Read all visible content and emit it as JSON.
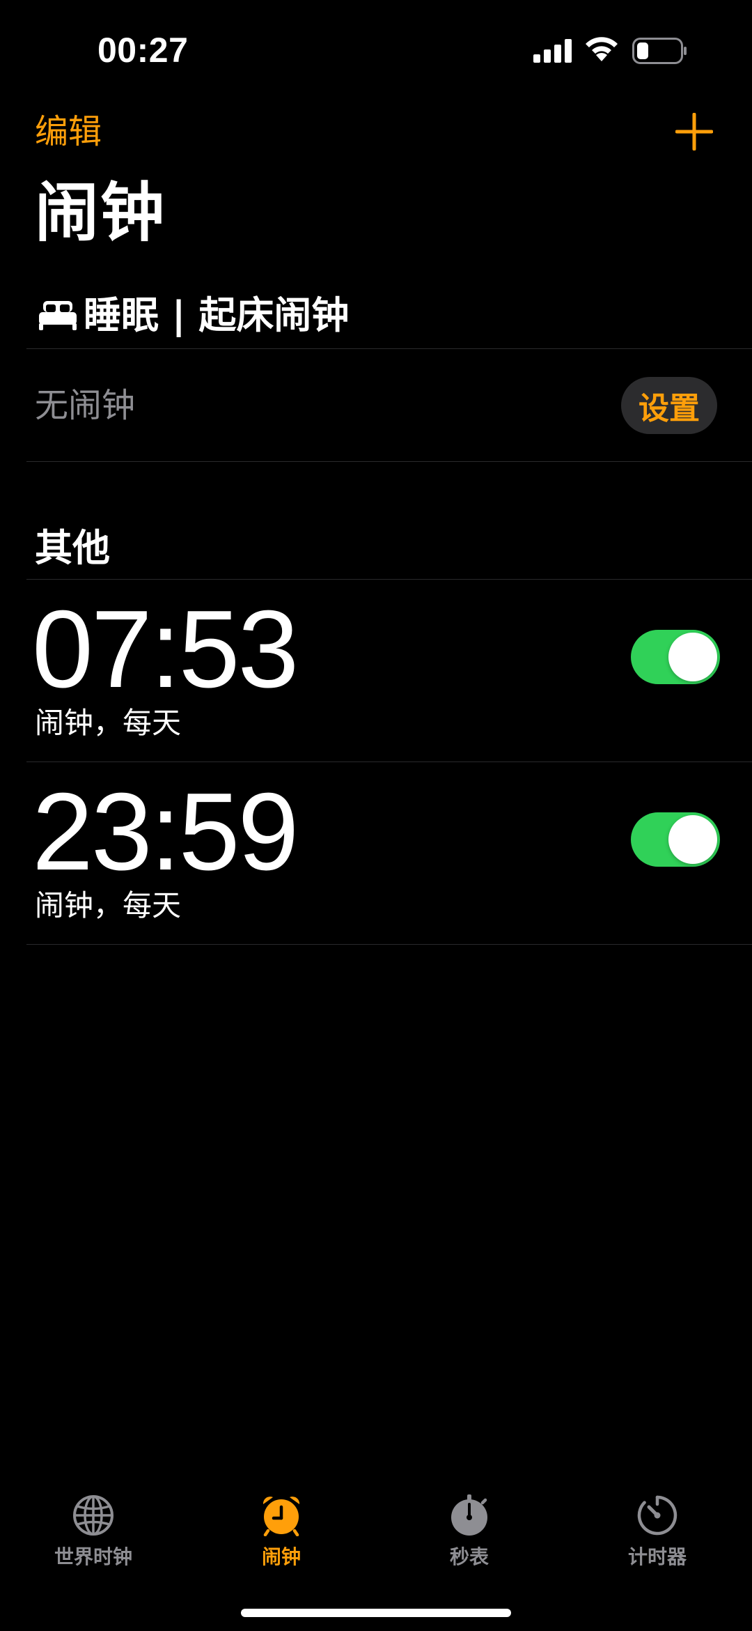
{
  "status_bar": {
    "time": "00:27",
    "icons": [
      "cellular-signal-icon",
      "wifi-icon",
      "battery-icon"
    ]
  },
  "nav": {
    "edit_label": "编辑",
    "add_icon": "plus-icon",
    "title": "闹钟"
  },
  "sleep": {
    "icon": "bed-icon",
    "header": "睡眠 | 起床闹钟",
    "empty_text": "无闹钟",
    "setup_label": "设置"
  },
  "others": {
    "header": "其他",
    "alarms": [
      {
        "time": "07:53",
        "label": "闹钟，每天",
        "enabled": true
      },
      {
        "time": "23:59",
        "label": "闹钟，每天",
        "enabled": true
      }
    ]
  },
  "tabs": [
    {
      "label": "世界时钟",
      "icon": "globe-icon",
      "active": false
    },
    {
      "label": "闹钟",
      "icon": "alarm-clock-icon",
      "active": true
    },
    {
      "label": "秒表",
      "icon": "stopwatch-icon",
      "active": false
    },
    {
      "label": "计时器",
      "icon": "timer-icon",
      "active": false
    }
  ],
  "colors": {
    "accent": "#ff9f0a",
    "toggle_on": "#30d158",
    "secondary_text": "#8e8e93",
    "background": "#000000"
  }
}
